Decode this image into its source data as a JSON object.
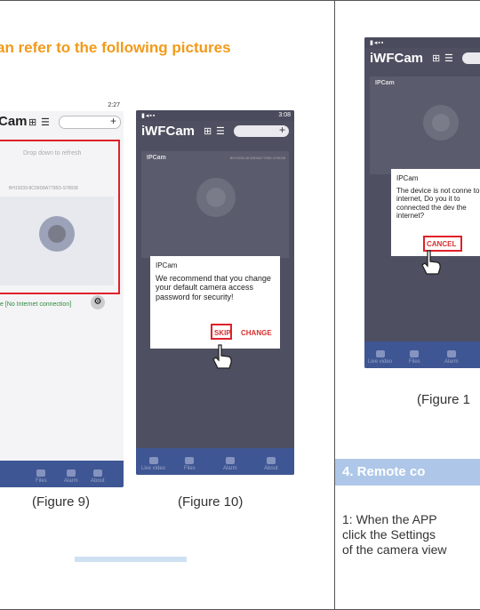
{
  "header": {
    "text": "an refer to the following pictures"
  },
  "captions": {
    "fig9": "(Figure 9)",
    "fig10": "(Figure 10)",
    "fig11": "(Figure 1"
  },
  "phone_app": {
    "title_a": "Cam",
    "title_b": "iWFCam",
    "title_c": "iWFCam"
  },
  "fig9": {
    "time": "2:27",
    "refresh_hint": "Drop down to refresh",
    "device_id": "BH15039-8C09D8A7795D-S78038",
    "status": "e [No Internet connection]",
    "tabs": [
      "Files",
      "Alarm",
      "About"
    ]
  },
  "fig10": {
    "time": "3:08",
    "cam_name": "IPCam",
    "device_id": "BH15039-8C09D8A7795D-S78038",
    "dialog_title": "IPCam",
    "dialog_text": "We recommend that you change your default camera access password for security!",
    "skip": "SKIP",
    "change": "CHANGE",
    "tabs": [
      "Live video",
      "Files",
      "Alarm",
      "About"
    ]
  },
  "fig11": {
    "cam_name": "IPCam",
    "dialog_title": "IPCam",
    "dialog_text": "The device is not conne to the internet, Do you it to connected the dev the internet?",
    "cancel": "CANCEL",
    "tabs": [
      "Live video",
      "Files",
      "Alarm"
    ]
  },
  "section": {
    "title": "4. Remote co"
  },
  "paragraph": {
    "line1": "1: When the APP",
    "line2": "click the Settings",
    "line3": "of the camera view"
  },
  "colors": {
    "orange": "#f29a1a",
    "red": "#e0202a",
    "tabbar": "#3f5694",
    "section": "#aec7e8"
  }
}
